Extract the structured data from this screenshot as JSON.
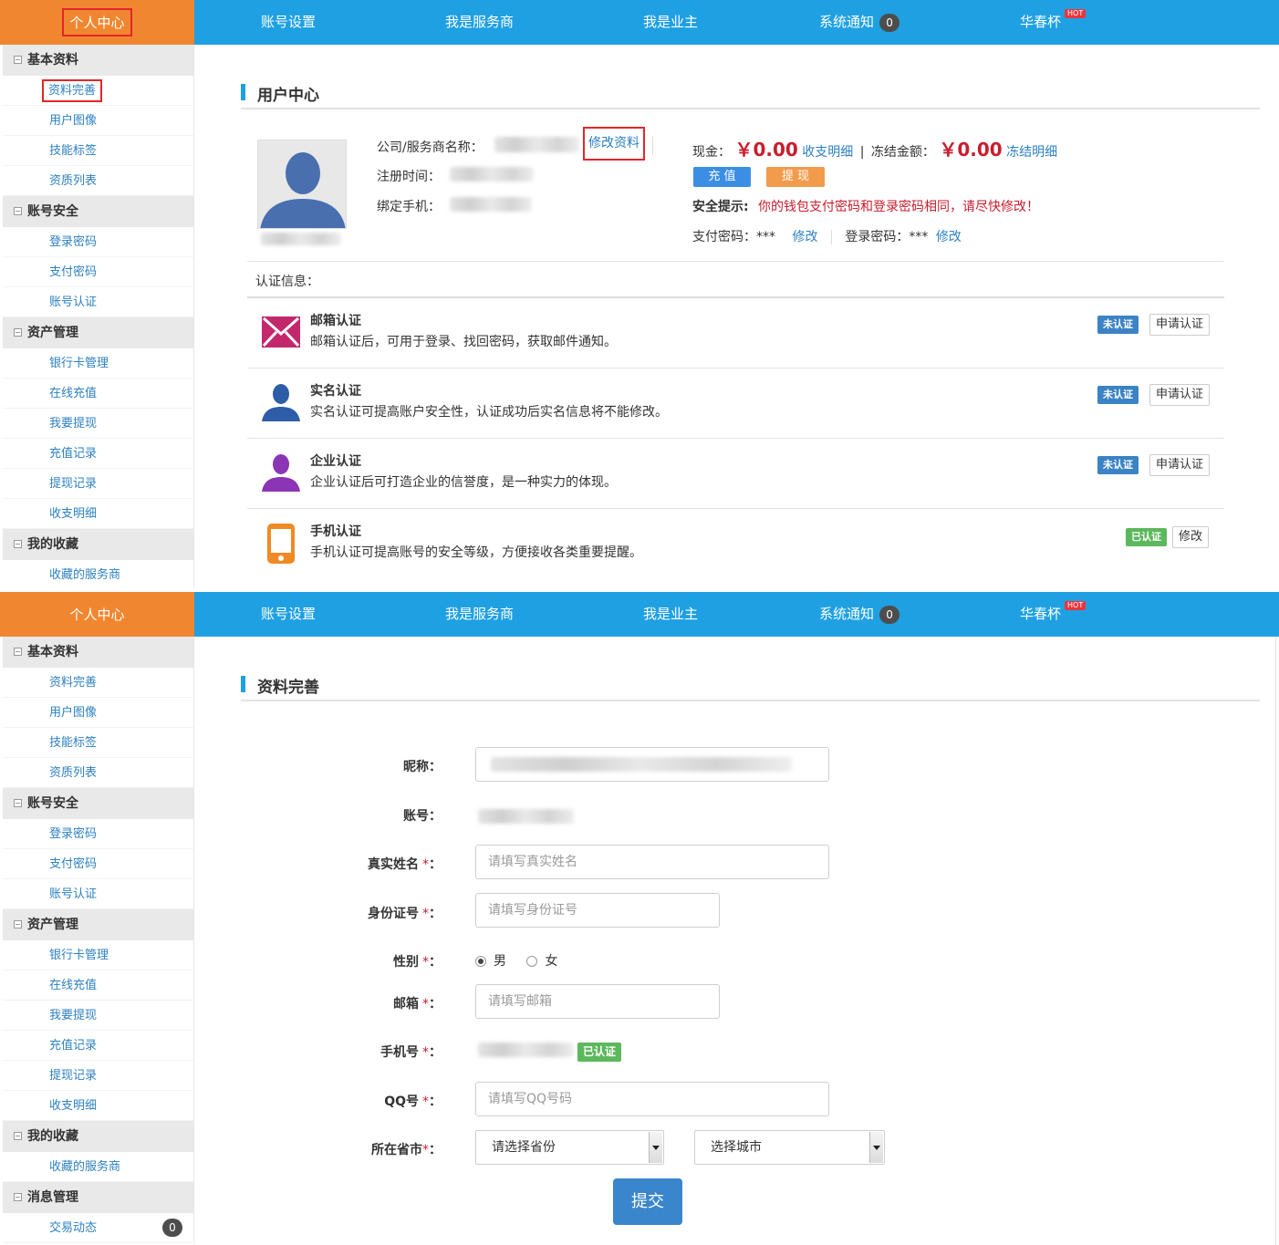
{
  "nav": {
    "home": "个人中心",
    "account_settings": "账号设置",
    "provider": "我是服务商",
    "owner": "我是业主",
    "notice": "系统通知",
    "notice_count": "0",
    "cup": "华春杯",
    "hot": "HOT"
  },
  "sidebar": {
    "basic": {
      "title": "基本资料",
      "items": [
        "资料完善",
        "用户图像",
        "技能标签",
        "资质列表"
      ]
    },
    "security": {
      "title": "账号安全",
      "items": [
        "登录密码",
        "支付密码",
        "账号认证"
      ]
    },
    "assets": {
      "title": "资产管理",
      "items": [
        "银行卡管理",
        "在线充值",
        "我要提现",
        "充值记录",
        "提现记录",
        "收支明细"
      ]
    },
    "favorites": {
      "title": "我的收藏",
      "items": [
        "收藏的服务商"
      ]
    },
    "messages": {
      "title": "消息管理",
      "items": [
        "交易动态"
      ],
      "badge": "0"
    }
  },
  "user_center": {
    "title": "用户中心",
    "company_label": "公司/服务商名称：",
    "edit_profile": "修改资料",
    "register_label": "注册时间：",
    "phone_label": "绑定手机：",
    "cash_label": "现金：",
    "cash_value": "￥0.00",
    "cash_detail": "收支明细",
    "sep": "|",
    "frozen_label": "冻结金额：",
    "frozen_value": "￥0.00",
    "frozen_detail": "冻结明细",
    "recharge": "充 值",
    "withdraw": "提 现",
    "tip_label": "安全提示:",
    "tip_text": "你的钱包支付密码和登录密码相同，请尽快修改！",
    "pay_pwd": "支付密码：***",
    "modify": "修改",
    "login_pwd": "登录密码：***",
    "cert_title": "认证信息："
  },
  "certs": [
    {
      "title": "邮箱认证",
      "desc": "邮箱认证后，可用于登录、找回密码，获取邮件通知。",
      "status": "未认证",
      "action": "申请认证",
      "color": "#c2286b"
    },
    {
      "title": "实名认证",
      "desc": "实名认证可提高账户安全性，认证成功后实名信息将不能修改。",
      "status": "未认证",
      "action": "申请认证",
      "color": "#2e5da8"
    },
    {
      "title": "企业认证",
      "desc": "企业认证后可打造企业的信誉度，是一种实力的体现。",
      "status": "未认证",
      "action": "申请认证",
      "color": "#8b34b5"
    },
    {
      "title": "手机认证",
      "desc": "手机认证可提高账号的安全等级，方便接收各类重要提醒。",
      "status": "已认证",
      "action": "修改",
      "color": "#f08a24"
    }
  ],
  "profile_form": {
    "title": "资料完善",
    "nickname_label": "昵称：",
    "account_label": "账号：",
    "realname_label": "真实姓名",
    "realname_placeholder": "请填写真实姓名",
    "idcard_label": "身份证号",
    "idcard_placeholder": "请填写身份证号",
    "gender_label": "性别",
    "male": "男",
    "female": "女",
    "email_label": "邮箱",
    "email_placeholder": "请填写邮箱",
    "mobile_label": "手机号",
    "mobile_status": "已认证",
    "qq_label": "QQ号",
    "qq_placeholder": "请填写QQ号码",
    "city_label": "所在省市",
    "province_select": "请选择省份",
    "city_select": "选择城市",
    "required_mark": "*",
    "colon": "：",
    "submit": "提交"
  }
}
